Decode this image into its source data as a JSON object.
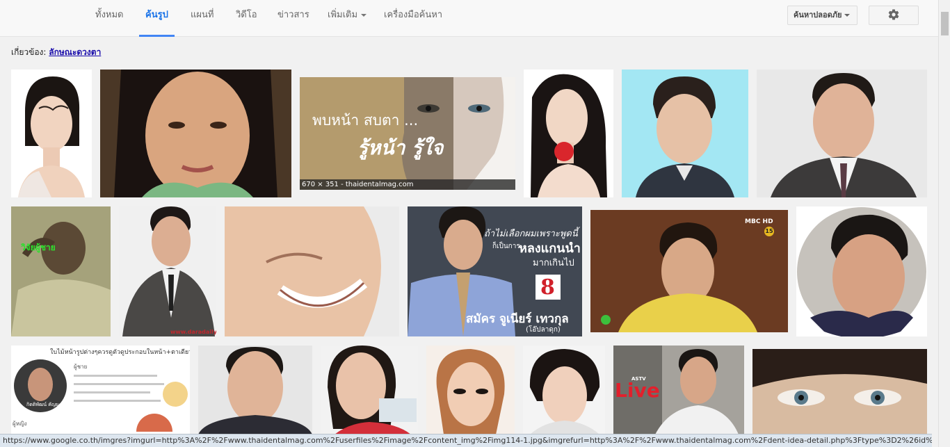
{
  "tabs": [
    {
      "label": "ทั้งหมด",
      "active": false
    },
    {
      "label": "ค้นรูป",
      "active": true
    },
    {
      "label": "แผนที่",
      "active": false
    },
    {
      "label": "วิดีโอ",
      "active": false
    },
    {
      "label": "ข่าวสาร",
      "active": false
    },
    {
      "label": "เพิ่มเติม",
      "active": false,
      "has_dropdown": true
    },
    {
      "label": "เครื่องมือค้นหา",
      "active": false
    }
  ],
  "safesearch": {
    "label": "ค้นหาปลอดภัย"
  },
  "settings": {
    "icon": "gear-icon"
  },
  "related": {
    "prefix": "เกี่ยวข้อง:",
    "link": "ลักษณะดวงตา"
  },
  "images": {
    "dental": {
      "headline1": "พบหน้า สบตา ...",
      "headline2": "รู้หน้า รู้ใจ",
      "caption": "670 × 351 - thaidentalmag.com"
    },
    "news": {
      "quote1": "ถ้าไม่เลือกผมเพราะพูดนี้",
      "quote2": "ก็เป็นการ",
      "quote3": "หลงแกนนำ",
      "quote4": "มากเกินไป",
      "number": "8",
      "name": "สมัคร จูเนียร์ เทวกุล",
      "nickname": "(โอ๊ปลาดุก)"
    },
    "mbc": {
      "logo": "MBC HD",
      "rating": "15"
    },
    "dara": {
      "watermark": "www.daradaily.co.th"
    },
    "sleep": {
      "text": "วิจัยผู้ชาย"
    },
    "astv": {
      "brand": "ASTV",
      "word": "Live"
    },
    "article": {
      "heading": "ใบไม้หน้ารูปต่างๆควรดูตัวดูประกอบในหน้า+ตาเดียว",
      "subtitle": "ผู้ชาย",
      "name_label": "กิตติพัฒน์ คัญยะ",
      "footer": "ผู้หญิง"
    }
  },
  "status_url": "https://www.google.co.th/imgres?imgurl=http%3A%2F%2Fwww.thaidentalmag.com%2Fuserfiles%2Fimage%2Fcontent_img%2Fimg114-1.jpg&imgrefurl=http%3A%2F%2Fwww.thaidentalmag.com%2Fdent-idea-detail.php%3Ftype%3D2%26id%3D294&..."
}
